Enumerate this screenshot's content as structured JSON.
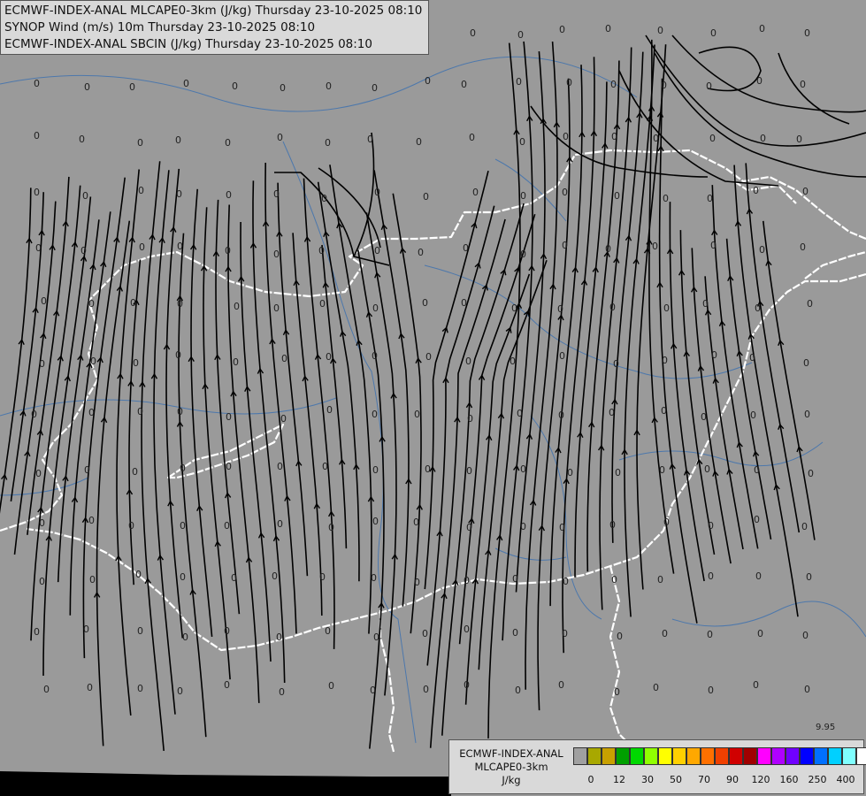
{
  "titles": [
    "ECMWF-INDEX-ANAL MLCAPE0-3km (J/kg) Thursday 23-10-2025 08:10",
    "SYNOP Wind (m/s) 10m Thursday 23-10-2025 08:10",
    "ECMWF-INDEX-ANAL SBCIN (J/kg) Thursday 23-10-2025 08:10"
  ],
  "legend": {
    "title_lines": [
      "ECMWF-INDEX-ANAL",
      "MLCAPE0-3km",
      "J/kg"
    ],
    "colors": [
      "#a0a0a0",
      "#a8a800",
      "#c8a000",
      "#00a000",
      "#00d800",
      "#90ff00",
      "#ffff00",
      "#ffd000",
      "#ffa800",
      "#ff7000",
      "#f04000",
      "#d00000",
      "#a00000",
      "#ff00ff",
      "#b000ff",
      "#7000ff",
      "#0000ff",
      "#0070ff",
      "#00d0ff",
      "#80ffff",
      "#ffffff"
    ],
    "ticks": [
      "0",
      "12",
      "30",
      "50",
      "70",
      "90",
      "120",
      "160",
      "250",
      "400"
    ]
  },
  "map": {
    "background": "#9a9a9a",
    "field_value_label": "0",
    "corner_value": "9.95",
    "border_color": "#ffffff",
    "river_color": "#3a6fb0",
    "streamline_color": "#000000"
  }
}
